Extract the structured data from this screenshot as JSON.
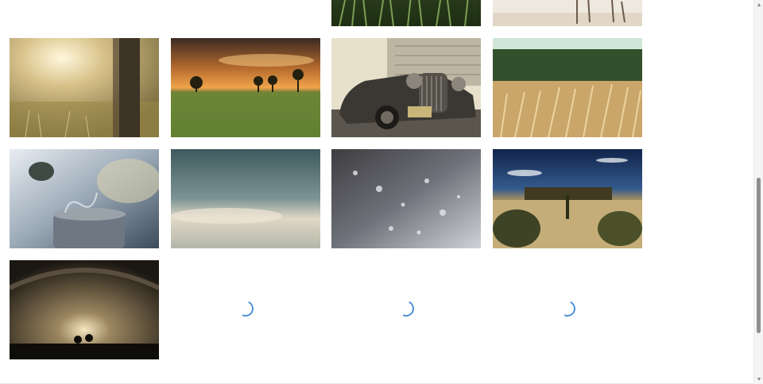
{
  "gallery": {
    "images": [
      {
        "subject": "grass-closeup",
        "row": "partial-top"
      },
      {
        "subject": "beach-scene",
        "row": "partial-top"
      },
      {
        "subject": "sunlit-meadow-tree"
      },
      {
        "subject": "sunset-field"
      },
      {
        "subject": "vintage-car"
      },
      {
        "subject": "wheat-field"
      },
      {
        "subject": "steaming-cup"
      },
      {
        "subject": "cloudy-sky"
      },
      {
        "subject": "water-droplets"
      },
      {
        "subject": "tuscany-villa"
      },
      {
        "subject": "concert-hall"
      }
    ],
    "loading_placeholders": 3
  },
  "scrollbar": {
    "up_icon": "▲",
    "down_icon": "▼"
  },
  "colors": {
    "background": "#ffffff",
    "spinner": "#4f8fd6",
    "scroll_thumb": "#8f8f8f"
  }
}
